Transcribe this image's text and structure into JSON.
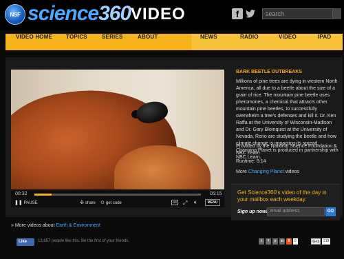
{
  "header": {
    "logo_text": "NSF",
    "brand": "science",
    "brand_num": "360",
    "section": "VIDEO",
    "search_placeholder": "search",
    "social": {
      "facebook": "f",
      "twitter": "t"
    }
  },
  "nav": {
    "items": [
      "VIDEO HOME",
      "TOPICS",
      "SERIES",
      "ABOUT",
      "NEWS",
      "RADIO",
      "VIDEO",
      "IPAD"
    ]
  },
  "player": {
    "current_time": "00:32",
    "duration": "05:15",
    "progress_pct": 10.2,
    "pause_label": "PAUSE",
    "share_label": "share",
    "embed_label": "get code",
    "cc_label": "CC",
    "menu_label": "MENU"
  },
  "description": {
    "title": "BARK BEETLE OUTBREAKS",
    "body": "Millions of pine trees are dying in western North America, all due to a beetle about the size of a grain of rice. The mountain pine beetle uses pheromones, a chemical that attracts other mountain pine beetles, to successfully overwhelm a tree's defenses and kill it. Dr. Ken Raffa at the University of Wisconsin-Madison and Dr. Gary Blomquist at the University of Nevada, Reno are studying the beetle and how climate change is impacting its spread. Changing Planet is produced in partnership with NBC Learn.",
    "credit": "Provided by the National Science Foundation & NBC Learn",
    "runtime": "Runtime: 5:14",
    "more_prefix": "More ",
    "more_link": "Changing Planet",
    "more_suffix": " videos"
  },
  "signup": {
    "text": "Get Science360's video of the day in your mailbox each weekday.",
    "label": "Sign up now!",
    "placeholder": "email address",
    "button": "GO"
  },
  "related": {
    "prefix": "» More videos about ",
    "link": "Earth & Environment"
  },
  "social_bar": {
    "like_label": "Like",
    "like_text": "13,657 people like this. Be the first of your friends.",
    "share_icons": [
      "t",
      "f",
      "y",
      "in",
      "8"
    ],
    "share_count": "0",
    "gplus_label": "G+1",
    "gplus_count": "218"
  }
}
